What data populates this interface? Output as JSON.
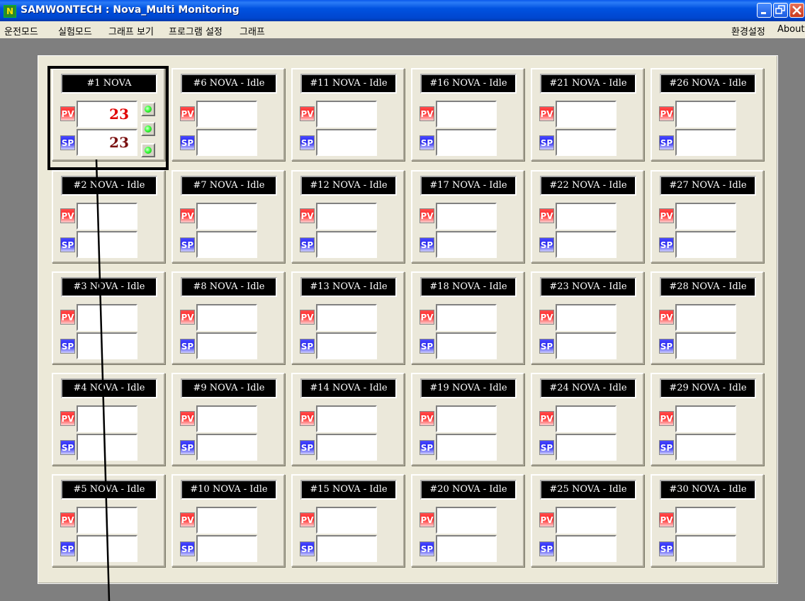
{
  "window": {
    "app_icon": "N",
    "title": "SAMWONTECH : Nova_Multi Monitoring",
    "buttons": [
      "minimize",
      "restore",
      "close"
    ]
  },
  "menu": {
    "left": [
      "운전모드",
      "실험모드",
      "그래프 보기",
      "프로그램 설정",
      "그래프"
    ],
    "right": [
      "환경설정",
      "About"
    ]
  },
  "channels": [
    {
      "label": "#1 NOVA",
      "pv": "23",
      "sp": "23",
      "leds": true
    },
    {
      "label": "#2 NOVA - Idle",
      "pv": "",
      "sp": ""
    },
    {
      "label": "#3 NOVA - Idle",
      "pv": "",
      "sp": ""
    },
    {
      "label": "#4 NOVA - Idle",
      "pv": "",
      "sp": ""
    },
    {
      "label": "#5 NOVA - Idle",
      "pv": "",
      "sp": ""
    },
    {
      "label": "#6 NOVA - Idle",
      "pv": "",
      "sp": ""
    },
    {
      "label": "#7 NOVA - Idle",
      "pv": "",
      "sp": ""
    },
    {
      "label": "#8 NOVA - Idle",
      "pv": "",
      "sp": ""
    },
    {
      "label": "#9 NOVA - Idle",
      "pv": "",
      "sp": ""
    },
    {
      "label": "#10 NOVA - Idle",
      "pv": "",
      "sp": ""
    },
    {
      "label": "#11 NOVA - Idle",
      "pv": "",
      "sp": ""
    },
    {
      "label": "#12 NOVA - Idle",
      "pv": "",
      "sp": ""
    },
    {
      "label": "#13 NOVA - Idle",
      "pv": "",
      "sp": ""
    },
    {
      "label": "#14 NOVA - Idle",
      "pv": "",
      "sp": ""
    },
    {
      "label": "#15 NOVA - Idle",
      "pv": "",
      "sp": ""
    },
    {
      "label": "#16 NOVA - Idle",
      "pv": "",
      "sp": ""
    },
    {
      "label": "#17 NOVA - Idle",
      "pv": "",
      "sp": ""
    },
    {
      "label": "#18 NOVA - Idle",
      "pv": "",
      "sp": ""
    },
    {
      "label": "#19 NOVA - Idle",
      "pv": "",
      "sp": ""
    },
    {
      "label": "#20 NOVA - Idle",
      "pv": "",
      "sp": ""
    },
    {
      "label": "#21 NOVA - Idle",
      "pv": "",
      "sp": ""
    },
    {
      "label": "#22 NOVA - Idle",
      "pv": "",
      "sp": ""
    },
    {
      "label": "#23 NOVA - Idle",
      "pv": "",
      "sp": ""
    },
    {
      "label": "#24 NOVA - Idle",
      "pv": "",
      "sp": ""
    },
    {
      "label": "#25 NOVA - Idle",
      "pv": "",
      "sp": ""
    },
    {
      "label": "#26 NOVA - Idle",
      "pv": "",
      "sp": ""
    },
    {
      "label": "#27 NOVA - Idle",
      "pv": "",
      "sp": ""
    },
    {
      "label": "#28 NOVA - Idle",
      "pv": "",
      "sp": ""
    },
    {
      "label": "#29 NOVA - Idle",
      "pv": "",
      "sp": ""
    },
    {
      "label": "#30 NOVA - Idle",
      "pv": "",
      "sp": ""
    }
  ],
  "tags": {
    "pv": "PV",
    "sp": "SP"
  },
  "colors": {
    "title_bar": "#0052e0",
    "panel": "#ece9d8",
    "pv_value": "#e00000",
    "sp_value": "#7a1010",
    "led_on": "#3aff3a"
  }
}
